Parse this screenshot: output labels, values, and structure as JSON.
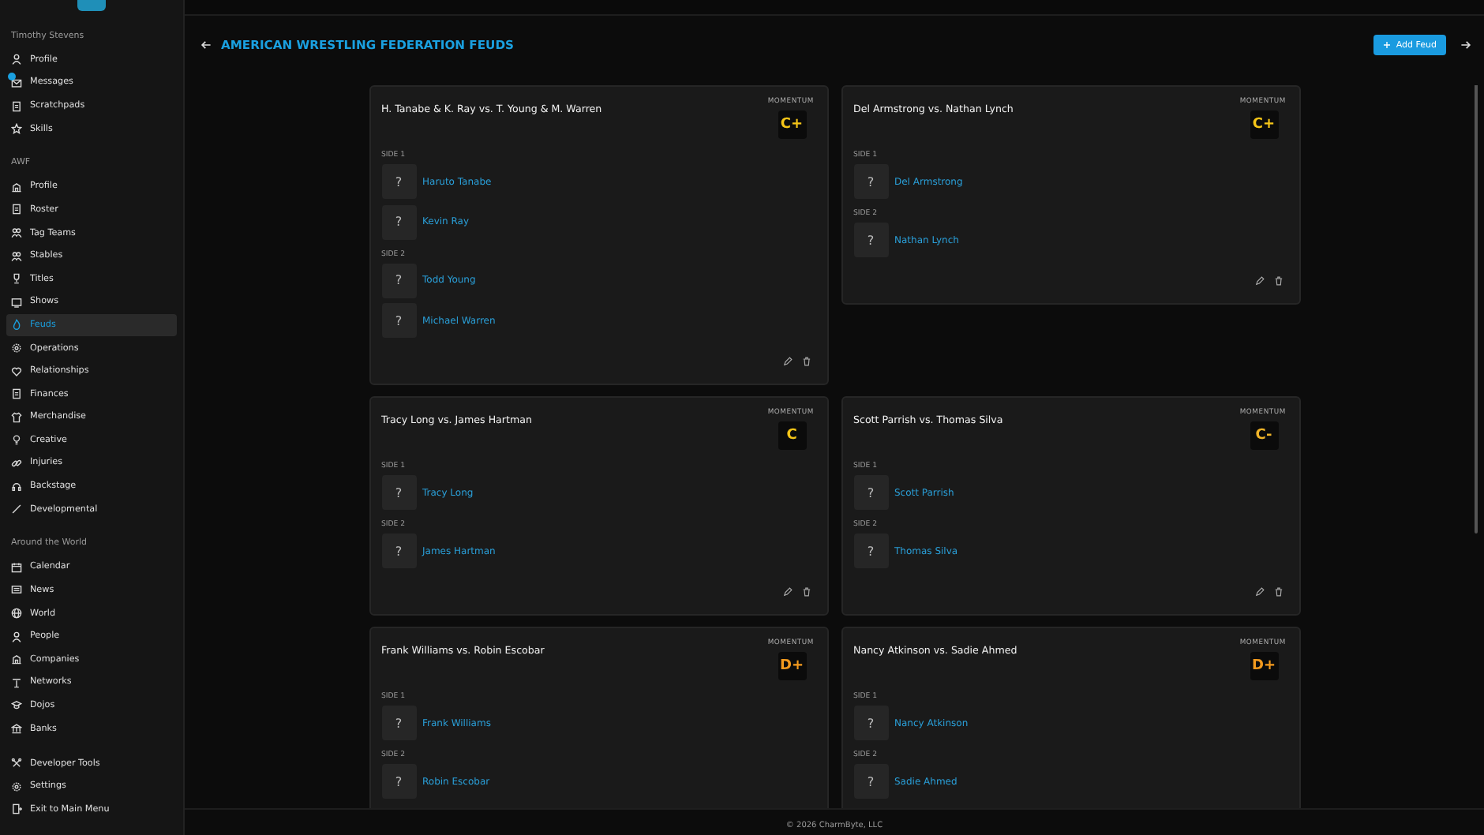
{
  "sidebar": {
    "sections": [
      {
        "title": "Timothy Stevens",
        "items": [
          {
            "label": "Profile",
            "selected": false,
            "unread": false
          },
          {
            "label": "Messages",
            "selected": false,
            "unread": true
          },
          {
            "label": "Scratchpads",
            "selected": false,
            "unread": false
          },
          {
            "label": "Skills",
            "selected": false,
            "unread": false
          }
        ]
      },
      {
        "title": "AWF",
        "items": [
          {
            "label": "Profile",
            "selected": false,
            "unread": false
          },
          {
            "label": "Roster",
            "selected": false,
            "unread": false
          },
          {
            "label": "Tag Teams",
            "selected": false,
            "unread": false
          },
          {
            "label": "Stables",
            "selected": false,
            "unread": false
          },
          {
            "label": "Titles",
            "selected": false,
            "unread": false
          },
          {
            "label": "Shows",
            "selected": false,
            "unread": false
          },
          {
            "label": "Feuds",
            "selected": true,
            "unread": false
          },
          {
            "label": "Operations",
            "selected": false,
            "unread": false
          },
          {
            "label": "Relationships",
            "selected": false,
            "unread": false
          },
          {
            "label": "Finances",
            "selected": false,
            "unread": false
          },
          {
            "label": "Merchandise",
            "selected": false,
            "unread": false
          },
          {
            "label": "Creative",
            "selected": false,
            "unread": false
          },
          {
            "label": "Injuries",
            "selected": false,
            "unread": false
          },
          {
            "label": "Backstage",
            "selected": false,
            "unread": false
          },
          {
            "label": "Developmental",
            "selected": false,
            "unread": false
          }
        ]
      },
      {
        "title": "Around the World",
        "items": [
          {
            "label": "Calendar",
            "selected": false,
            "unread": false
          },
          {
            "label": "News",
            "selected": false,
            "unread": false
          },
          {
            "label": "World",
            "selected": false,
            "unread": false
          },
          {
            "label": "People",
            "selected": false,
            "unread": false
          },
          {
            "label": "Companies",
            "selected": false,
            "unread": false
          },
          {
            "label": "Networks",
            "selected": false,
            "unread": false
          },
          {
            "label": "Dojos",
            "selected": false,
            "unread": false
          },
          {
            "label": "Banks",
            "selected": false,
            "unread": false
          }
        ]
      },
      {
        "items": [
          {
            "label": "Developer Tools",
            "selected": false,
            "unread": false
          },
          {
            "label": "Settings",
            "selected": false,
            "unread": false
          },
          {
            "label": "Exit to Main Menu",
            "selected": false,
            "unread": false
          }
        ]
      }
    ]
  },
  "header": {
    "title": "AMERICAN WRESTLING FEDERATION FEUDS",
    "add_button": "Add Feud"
  },
  "feuds": [
    {
      "title": "H. Tanabe & K. Ray vs. T. Young & M. Warren",
      "momentum_label": "MOMENTUM",
      "grade": "C+",
      "color": "#f5c518",
      "sides": [
        {
          "label": "SIDE 1",
          "wrestlers": [
            {
              "avatar": "?",
              "name": "Haruto Tanabe"
            },
            {
              "avatar": "?",
              "name": "Kevin Ray"
            }
          ]
        },
        {
          "label": "SIDE 2",
          "wrestlers": [
            {
              "avatar": "?",
              "name": "Todd Young"
            },
            {
              "avatar": "?",
              "name": "Michael Warren"
            }
          ]
        }
      ]
    },
    {
      "title": "Del Armstrong vs. Nathan Lynch",
      "momentum_label": "MOMENTUM",
      "grade": "C+",
      "color": "#f5c518",
      "sides": [
        {
          "label": "SIDE 1",
          "wrestlers": [
            {
              "avatar": "?",
              "name": "Del Armstrong"
            }
          ]
        },
        {
          "label": "SIDE 2",
          "wrestlers": [
            {
              "avatar": "?",
              "name": "Nathan Lynch"
            }
          ]
        }
      ]
    },
    {
      "title": "Tracy Long vs. James Hartman",
      "momentum_label": "MOMENTUM",
      "grade": "C",
      "color": "#f5c518",
      "sides": [
        {
          "label": "SIDE 1",
          "wrestlers": [
            {
              "avatar": "?",
              "name": "Tracy Long"
            }
          ]
        },
        {
          "label": "SIDE 2",
          "wrestlers": [
            {
              "avatar": "?",
              "name": "James Hartman"
            }
          ]
        }
      ]
    },
    {
      "title": "Scott Parrish vs. Thomas Silva",
      "momentum_label": "MOMENTUM",
      "grade": "C-",
      "color": "#f0b429",
      "sides": [
        {
          "label": "SIDE 1",
          "wrestlers": [
            {
              "avatar": "?",
              "name": "Scott Parrish"
            }
          ]
        },
        {
          "label": "SIDE 2",
          "wrestlers": [
            {
              "avatar": "?",
              "name": "Thomas Silva"
            }
          ]
        }
      ]
    },
    {
      "title": "Frank Williams vs. Robin Escobar",
      "momentum_label": "MOMENTUM",
      "grade": "D+",
      "color": "#f39a1e",
      "sides": [
        {
          "label": "SIDE 1",
          "wrestlers": [
            {
              "avatar": "?",
              "name": "Frank Williams"
            }
          ]
        },
        {
          "label": "SIDE 2",
          "wrestlers": [
            {
              "avatar": "?",
              "name": "Robin Escobar"
            }
          ]
        }
      ]
    },
    {
      "title": "Nancy Atkinson vs. Sadie Ahmed",
      "momentum_label": "MOMENTUM",
      "grade": "D+",
      "color": "#f39a1e",
      "sides": [
        {
          "label": "SIDE 1",
          "wrestlers": [
            {
              "avatar": "?",
              "name": "Nancy Atkinson"
            }
          ]
        },
        {
          "label": "SIDE 2",
          "wrestlers": [
            {
              "avatar": "?",
              "name": "Sadie Ahmed"
            }
          ]
        }
      ]
    }
  ],
  "footer": "© 2026 CharmByte, LLC"
}
